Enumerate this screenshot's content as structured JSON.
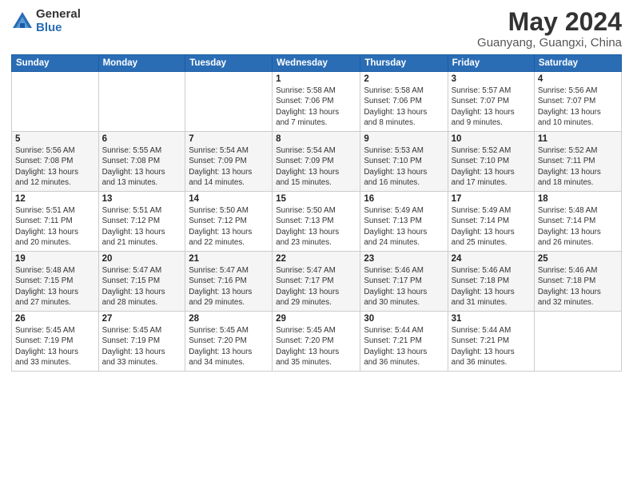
{
  "logo": {
    "general": "General",
    "blue": "Blue"
  },
  "title": "May 2024",
  "location": "Guanyang, Guangxi, China",
  "days_header": [
    "Sunday",
    "Monday",
    "Tuesday",
    "Wednesday",
    "Thursday",
    "Friday",
    "Saturday"
  ],
  "weeks": [
    [
      {
        "day": "",
        "info": ""
      },
      {
        "day": "",
        "info": ""
      },
      {
        "day": "",
        "info": ""
      },
      {
        "day": "1",
        "info": "Sunrise: 5:58 AM\nSunset: 7:06 PM\nDaylight: 13 hours\nand 7 minutes."
      },
      {
        "day": "2",
        "info": "Sunrise: 5:58 AM\nSunset: 7:06 PM\nDaylight: 13 hours\nand 8 minutes."
      },
      {
        "day": "3",
        "info": "Sunrise: 5:57 AM\nSunset: 7:07 PM\nDaylight: 13 hours\nand 9 minutes."
      },
      {
        "day": "4",
        "info": "Sunrise: 5:56 AM\nSunset: 7:07 PM\nDaylight: 13 hours\nand 10 minutes."
      }
    ],
    [
      {
        "day": "5",
        "info": "Sunrise: 5:56 AM\nSunset: 7:08 PM\nDaylight: 13 hours\nand 12 minutes."
      },
      {
        "day": "6",
        "info": "Sunrise: 5:55 AM\nSunset: 7:08 PM\nDaylight: 13 hours\nand 13 minutes."
      },
      {
        "day": "7",
        "info": "Sunrise: 5:54 AM\nSunset: 7:09 PM\nDaylight: 13 hours\nand 14 minutes."
      },
      {
        "day": "8",
        "info": "Sunrise: 5:54 AM\nSunset: 7:09 PM\nDaylight: 13 hours\nand 15 minutes."
      },
      {
        "day": "9",
        "info": "Sunrise: 5:53 AM\nSunset: 7:10 PM\nDaylight: 13 hours\nand 16 minutes."
      },
      {
        "day": "10",
        "info": "Sunrise: 5:52 AM\nSunset: 7:10 PM\nDaylight: 13 hours\nand 17 minutes."
      },
      {
        "day": "11",
        "info": "Sunrise: 5:52 AM\nSunset: 7:11 PM\nDaylight: 13 hours\nand 18 minutes."
      }
    ],
    [
      {
        "day": "12",
        "info": "Sunrise: 5:51 AM\nSunset: 7:11 PM\nDaylight: 13 hours\nand 20 minutes."
      },
      {
        "day": "13",
        "info": "Sunrise: 5:51 AM\nSunset: 7:12 PM\nDaylight: 13 hours\nand 21 minutes."
      },
      {
        "day": "14",
        "info": "Sunrise: 5:50 AM\nSunset: 7:12 PM\nDaylight: 13 hours\nand 22 minutes."
      },
      {
        "day": "15",
        "info": "Sunrise: 5:50 AM\nSunset: 7:13 PM\nDaylight: 13 hours\nand 23 minutes."
      },
      {
        "day": "16",
        "info": "Sunrise: 5:49 AM\nSunset: 7:13 PM\nDaylight: 13 hours\nand 24 minutes."
      },
      {
        "day": "17",
        "info": "Sunrise: 5:49 AM\nSunset: 7:14 PM\nDaylight: 13 hours\nand 25 minutes."
      },
      {
        "day": "18",
        "info": "Sunrise: 5:48 AM\nSunset: 7:14 PM\nDaylight: 13 hours\nand 26 minutes."
      }
    ],
    [
      {
        "day": "19",
        "info": "Sunrise: 5:48 AM\nSunset: 7:15 PM\nDaylight: 13 hours\nand 27 minutes."
      },
      {
        "day": "20",
        "info": "Sunrise: 5:47 AM\nSunset: 7:15 PM\nDaylight: 13 hours\nand 28 minutes."
      },
      {
        "day": "21",
        "info": "Sunrise: 5:47 AM\nSunset: 7:16 PM\nDaylight: 13 hours\nand 29 minutes."
      },
      {
        "day": "22",
        "info": "Sunrise: 5:47 AM\nSunset: 7:17 PM\nDaylight: 13 hours\nand 29 minutes."
      },
      {
        "day": "23",
        "info": "Sunrise: 5:46 AM\nSunset: 7:17 PM\nDaylight: 13 hours\nand 30 minutes."
      },
      {
        "day": "24",
        "info": "Sunrise: 5:46 AM\nSunset: 7:18 PM\nDaylight: 13 hours\nand 31 minutes."
      },
      {
        "day": "25",
        "info": "Sunrise: 5:46 AM\nSunset: 7:18 PM\nDaylight: 13 hours\nand 32 minutes."
      }
    ],
    [
      {
        "day": "26",
        "info": "Sunrise: 5:45 AM\nSunset: 7:19 PM\nDaylight: 13 hours\nand 33 minutes."
      },
      {
        "day": "27",
        "info": "Sunrise: 5:45 AM\nSunset: 7:19 PM\nDaylight: 13 hours\nand 33 minutes."
      },
      {
        "day": "28",
        "info": "Sunrise: 5:45 AM\nSunset: 7:20 PM\nDaylight: 13 hours\nand 34 minutes."
      },
      {
        "day": "29",
        "info": "Sunrise: 5:45 AM\nSunset: 7:20 PM\nDaylight: 13 hours\nand 35 minutes."
      },
      {
        "day": "30",
        "info": "Sunrise: 5:44 AM\nSunset: 7:21 PM\nDaylight: 13 hours\nand 36 minutes."
      },
      {
        "day": "31",
        "info": "Sunrise: 5:44 AM\nSunset: 7:21 PM\nDaylight: 13 hours\nand 36 minutes."
      },
      {
        "day": "",
        "info": ""
      }
    ]
  ]
}
